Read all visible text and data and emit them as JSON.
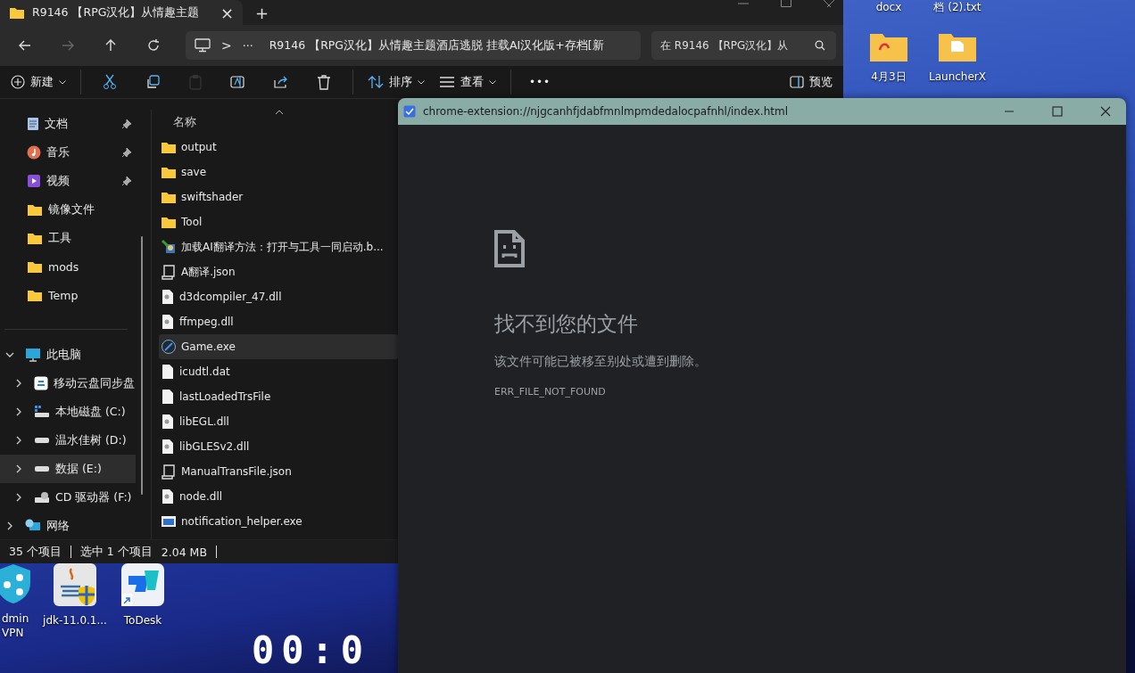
{
  "desktop": {
    "icons": [
      {
        "kind": "label-only",
        "label": "docx"
      },
      {
        "kind": "label-only",
        "label": "档 (2).txt"
      },
      {
        "kind": "folder-pdf",
        "label": "4月3日"
      },
      {
        "kind": "folder-doc",
        "label": "LauncherX"
      },
      {
        "kind": "vpn",
        "label": "dmin VPN"
      },
      {
        "kind": "java",
        "label": "jdk-11.0.1..."
      },
      {
        "kind": "todesk",
        "label": "ToDesk"
      }
    ],
    "clock": "00:0"
  },
  "explorer": {
    "tab": {
      "title": "R9146 【RPG汉化】从情趣主题",
      "close": "×"
    },
    "new_tab": "+",
    "nav_buttons": [
      {
        "kind": "back",
        "disabled": false
      },
      {
        "kind": "forward",
        "disabled": true
      },
      {
        "kind": "up",
        "disabled": false
      },
      {
        "kind": "refresh",
        "disabled": false
      }
    ],
    "address": {
      "separator": ">",
      "more": "···",
      "path": "R9146 【RPG汉化】从情趣主题酒店逃脱 挂载AI汉化版+存档[新"
    },
    "search": {
      "placeholder": "在 R9146 【RPG汉化】从"
    },
    "toolbar": [
      {
        "kind": "new",
        "label": "新建",
        "disabled": false
      },
      {
        "kind": "cut",
        "disabled": false
      },
      {
        "kind": "copy",
        "disabled": false
      },
      {
        "kind": "paste",
        "disabled": true
      },
      {
        "kind": "rename",
        "disabled": false
      },
      {
        "kind": "share",
        "disabled": false
      },
      {
        "kind": "delete",
        "disabled": false
      },
      {
        "kind": "sort",
        "label": "排序",
        "disabled": false
      },
      {
        "kind": "view",
        "label": "查看",
        "disabled": false
      },
      {
        "kind": "more",
        "label": "•••",
        "disabled": false
      }
    ],
    "preview": "预览",
    "quick_access": [
      {
        "kind": "documents",
        "label": "文档",
        "pinned": true,
        "selected": false
      },
      {
        "kind": "music",
        "label": "音乐",
        "pinned": true,
        "selected": false
      },
      {
        "kind": "videos",
        "label": "视频",
        "pinned": true,
        "selected": false
      },
      {
        "kind": "folder",
        "label": "镜像文件",
        "pinned": false,
        "selected": false
      },
      {
        "kind": "folder",
        "label": "工具",
        "pinned": false,
        "selected": false
      },
      {
        "kind": "folder",
        "label": "mods",
        "pinned": false,
        "selected": false
      },
      {
        "kind": "folder",
        "label": "Temp",
        "pinned": false,
        "selected": false
      }
    ],
    "tree": [
      {
        "kind": "pc",
        "label": "此电脑",
        "expanded": true,
        "selected": false,
        "children": [
          {
            "kind": "cloud",
            "label": "移动云盘同步盘",
            "expanded": false,
            "selected": false
          },
          {
            "kind": "system-drive",
            "label": "本地磁盘 (C:)",
            "expanded": false,
            "selected": false
          },
          {
            "kind": "drive",
            "label": "温水佳树 (D:)",
            "expanded": false,
            "selected": false
          },
          {
            "kind": "drive",
            "label": "数据 (E:)",
            "expanded": false,
            "selected": true
          },
          {
            "kind": "cd-drive",
            "label": "CD 驱动器 (F:)",
            "expanded": false,
            "selected": false
          }
        ]
      },
      {
        "kind": "network",
        "label": "网络",
        "expanded": false,
        "selected": false
      }
    ],
    "column": "名称",
    "files": [
      {
        "kind": "folder",
        "name": "output",
        "selected": false
      },
      {
        "kind": "folder",
        "name": "save",
        "selected": false
      },
      {
        "kind": "folder",
        "name": "swiftshader",
        "selected": false
      },
      {
        "kind": "folder",
        "name": "Tool",
        "selected": false
      },
      {
        "kind": "script",
        "name": "加载AI翻译方法：打开与工具一同启动.b...",
        "selected": false
      },
      {
        "kind": "json",
        "name": "A翻译.json",
        "selected": false
      },
      {
        "kind": "dll",
        "name": "d3dcompiler_47.dll",
        "selected": false
      },
      {
        "kind": "dll",
        "name": "ffmpeg.dll",
        "selected": false
      },
      {
        "kind": "exe",
        "name": "Game.exe",
        "selected": true
      },
      {
        "kind": "file",
        "name": "icudtl.dat",
        "selected": false
      },
      {
        "kind": "file",
        "name": "lastLoadedTrsFile",
        "selected": false
      },
      {
        "kind": "dll",
        "name": "libEGL.dll",
        "selected": false
      },
      {
        "kind": "dll",
        "name": "libGLESv2.dll",
        "selected": false
      },
      {
        "kind": "json",
        "name": "ManualTransFile.json",
        "selected": false
      },
      {
        "kind": "dll",
        "name": "node.dll",
        "selected": false
      },
      {
        "kind": "app",
        "name": "notification_helper.exe",
        "selected": false
      }
    ],
    "status": [
      "35 个项目",
      "选中 1 个项目",
      "2.04 MB"
    ]
  },
  "browser": {
    "title": "chrome-extension://njgcanhfjdabfmnlmpmdedalocpafnhl/index.html",
    "heading": "找不到您的文件",
    "message": "该文件可能已被移至别处或遭到删除。",
    "error_code": "ERR_FILE_NOT_FOUND"
  }
}
